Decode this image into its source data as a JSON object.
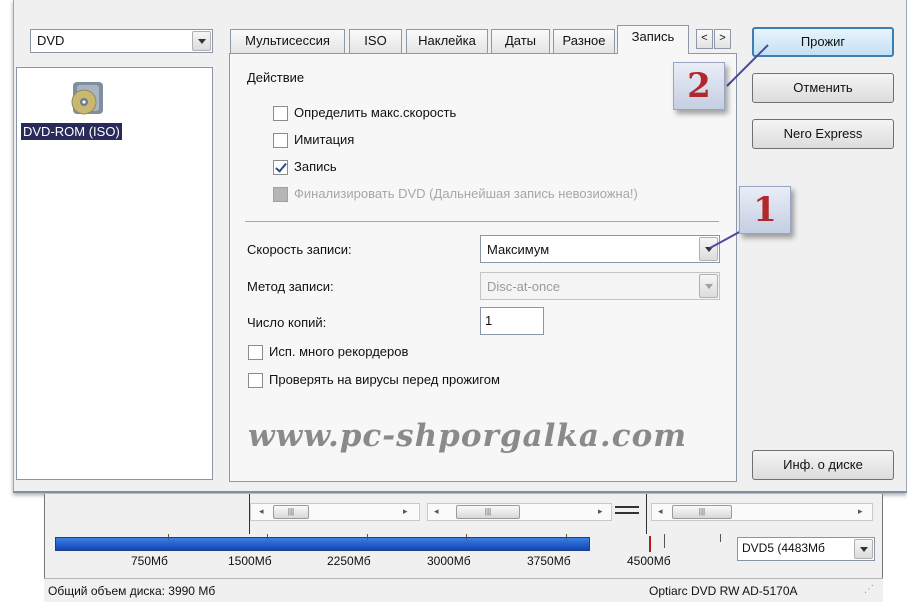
{
  "dialog": {
    "device_type_value": "DVD",
    "device_item_label": "DVD-ROM (ISO)",
    "tabs": [
      {
        "label": "Мультисессия"
      },
      {
        "label": "ISO"
      },
      {
        "label": "Наклейка"
      },
      {
        "label": "Даты"
      },
      {
        "label": "Разное"
      },
      {
        "label": "Запись",
        "active": true
      }
    ],
    "tab_scroll_left": "<",
    "tab_scroll_right": ">",
    "burn_tab": {
      "action_heading": "Действие",
      "options": [
        {
          "label": "Определить макс.скорость",
          "checked": false,
          "disabled": false
        },
        {
          "label": "Имитация",
          "checked": false,
          "disabled": false
        },
        {
          "label": "Запись",
          "checked": true,
          "disabled": false
        },
        {
          "label": "Финализировать DVD (Дальнейшая запись невозиожна!)",
          "checked": false,
          "disabled": true
        }
      ],
      "speed_label": "Скорость записи:",
      "speed_value": "Максимум",
      "method_label": "Метод записи:",
      "method_value": "Disc-at-once",
      "copies_label": "Число копий:",
      "copies_value": "1",
      "multi_recorder_label": "Исп. много рекордеров",
      "virus_check_label": "Проверять на вирусы перед прожигом"
    },
    "watermark": "www.pc-shporgalka.com",
    "buttons": {
      "burn": "Прожиг",
      "cancel": "Отменить",
      "nero_express": "Nero Express",
      "disc_info": "Инф. о диске"
    },
    "callouts": [
      "1",
      "2"
    ]
  },
  "main": {
    "capacity_scale": [
      "750Мб",
      "1500Мб",
      "2250Мб",
      "3000Мб",
      "3750Мб",
      "4500Мб"
    ],
    "disc_size_value": "DVD5 (4483Мб",
    "status_total": "Общий объем диска: 3990 Мб",
    "status_drive": "Optiarc  DVD RW AD-5170A"
  },
  "colors": {
    "callout_number": "#b2272b",
    "capacity_fill": "#1f5bd0",
    "limit_marker": "#b01e1e"
  }
}
